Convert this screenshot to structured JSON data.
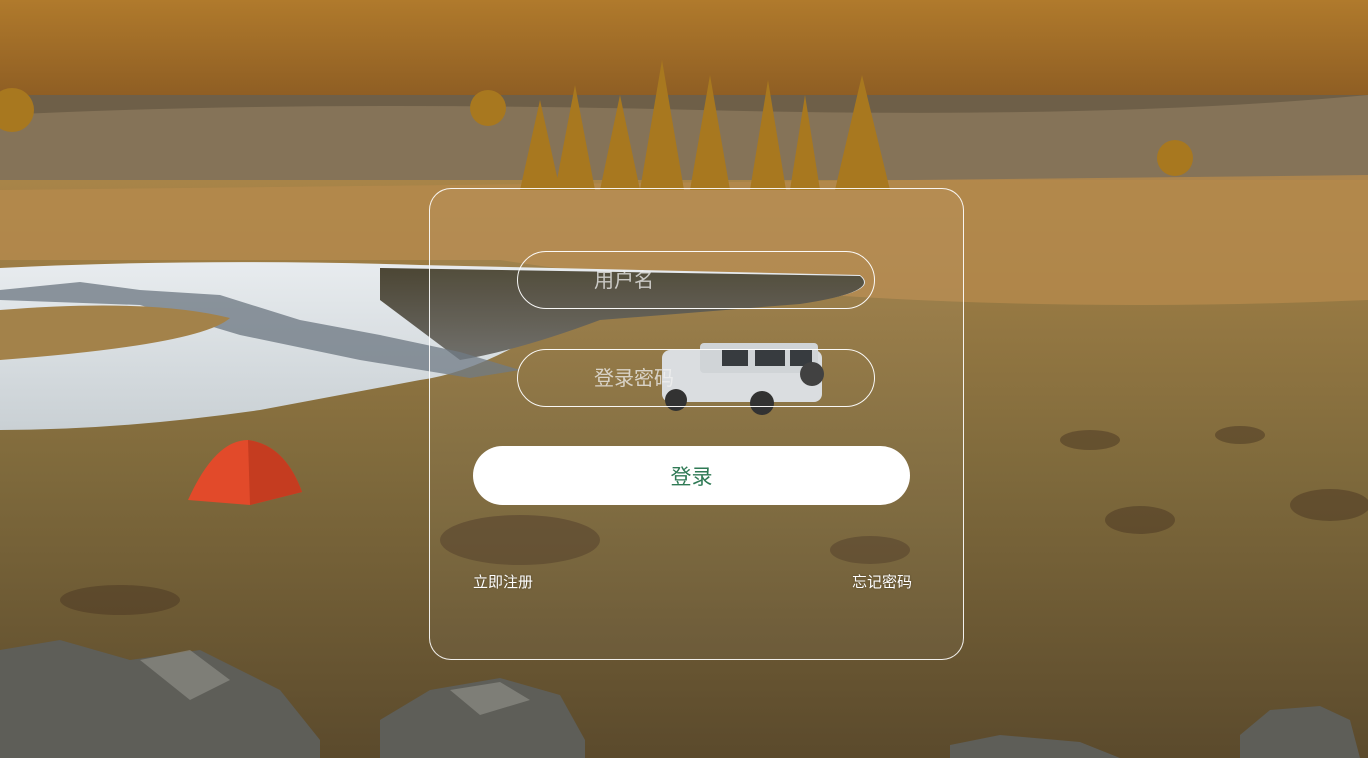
{
  "login": {
    "username_placeholder": "用户名",
    "password_placeholder": "登录密码",
    "submit_label": "登录",
    "register_link": "立即注册",
    "forgot_link": "忘记密码"
  },
  "colors": {
    "button_text": "#2f7a55",
    "button_bg": "#ffffff",
    "border": "#ffffff"
  }
}
